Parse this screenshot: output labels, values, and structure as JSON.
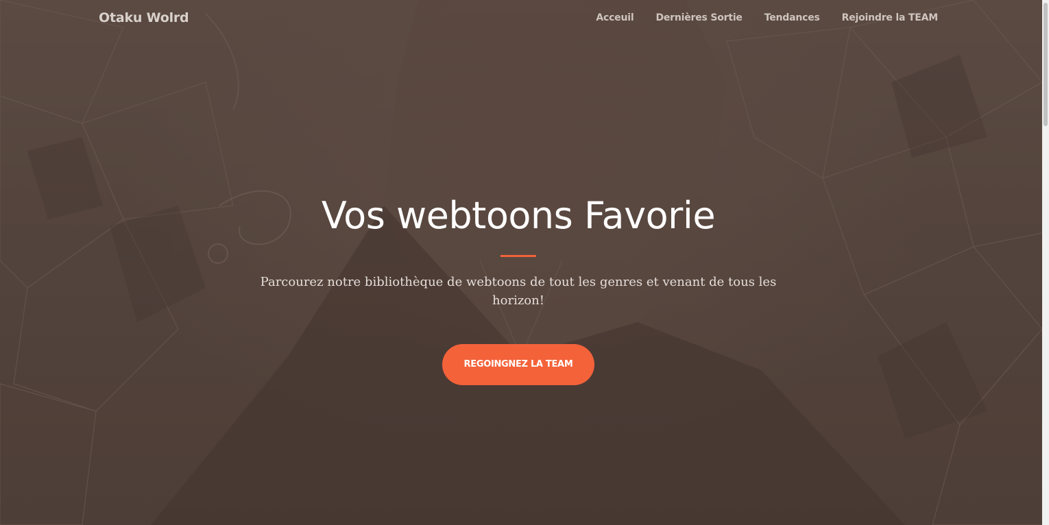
{
  "navbar": {
    "brand": "Otaku Wolrd",
    "links": [
      {
        "label": "Acceuil"
      },
      {
        "label": "Dernières Sortie"
      },
      {
        "label": "Tendances"
      },
      {
        "label": "Rejoindre la TEAM"
      }
    ]
  },
  "hero": {
    "title": "Vos webtoons Favorie",
    "subtitle": "Parcourez notre bibliothèque de webtoons de tout les genres et venant de tous les horizon!",
    "cta_label": "REGOINGNEZ LA TEAM"
  },
  "colors": {
    "accent": "#f4623a",
    "overlay": "#5c483e"
  }
}
